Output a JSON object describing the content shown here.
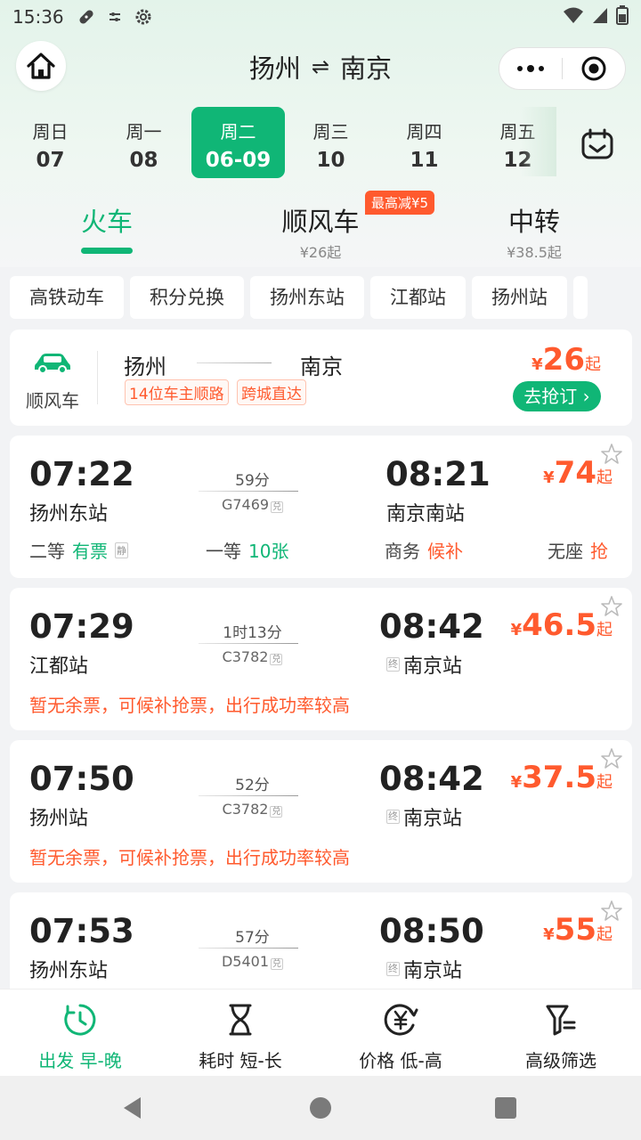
{
  "status": {
    "time": "15:36"
  },
  "header": {
    "from": "扬州",
    "to": "南京",
    "swap_symbol": "⇌"
  },
  "dates": [
    {
      "weekday": "周日",
      "day": "07"
    },
    {
      "weekday": "周一",
      "day": "08"
    },
    {
      "weekday": "周二",
      "day": "06-09",
      "active": true
    },
    {
      "weekday": "周三",
      "day": "10"
    },
    {
      "weekday": "周四",
      "day": "11"
    },
    {
      "weekday": "周五",
      "day": "12"
    }
  ],
  "modes": [
    {
      "label": "火车",
      "sub": ""
    },
    {
      "label": "顺风车",
      "sub": "¥26起",
      "promo": "最高减¥5"
    },
    {
      "label": "中转",
      "sub": "¥38.5起"
    }
  ],
  "filters": [
    "高铁动车",
    "积分兑换",
    "扬州东站",
    "江都站",
    "扬州站",
    ""
  ],
  "rideshare": {
    "label": "顺风车",
    "from": "扬州",
    "to": "南京",
    "tags": [
      "14位车主顺路",
      "跨城直达"
    ],
    "currency": "¥",
    "price": "26",
    "suffix": "起",
    "button": "去抢订"
  },
  "trains": [
    {
      "dep_time": "07:22",
      "dep_station": "扬州东站",
      "duration": "59分",
      "train_no": "G7469",
      "exchange_tag": "兑",
      "arr_time": "08:21",
      "arr_station": "南京南站",
      "terminal": false,
      "price": "74",
      "currency": "¥",
      "suffix": "起",
      "seats": [
        {
          "class": "二等",
          "status": "有票",
          "tone": "green",
          "quiet": "静"
        },
        {
          "class": "一等",
          "status": "10张",
          "tone": "green"
        },
        {
          "class": "商务",
          "status": "候补",
          "tone": "orange"
        },
        {
          "class": "无座",
          "status": "抢",
          "tone": "orange"
        }
      ]
    },
    {
      "dep_time": "07:29",
      "dep_station": "江都站",
      "duration": "1时13分",
      "train_no": "C3782",
      "exchange_tag": "兑",
      "arr_time": "08:42",
      "arr_station": "南京站",
      "terminal": true,
      "terminal_tag": "终",
      "price": "46.5",
      "currency": "¥",
      "suffix": "起",
      "notice": "暂无余票，可候补抢票，出行成功率较高"
    },
    {
      "dep_time": "07:50",
      "dep_station": "扬州站",
      "duration": "52分",
      "train_no": "C3782",
      "exchange_tag": "兑",
      "arr_time": "08:42",
      "arr_station": "南京站",
      "terminal": true,
      "terminal_tag": "终",
      "price": "37.5",
      "currency": "¥",
      "suffix": "起",
      "notice": "暂无余票，可候补抢票，出行成功率较高"
    },
    {
      "dep_time": "07:53",
      "dep_station": "扬州东站",
      "duration": "57分",
      "train_no": "D5401",
      "exchange_tag": "兑",
      "arr_time": "08:50",
      "arr_station": "南京站",
      "terminal": true,
      "terminal_tag": "终",
      "price": "55",
      "currency": "¥",
      "suffix": "起"
    }
  ],
  "bottom_tabs": [
    {
      "label": "出发 早-晚",
      "icon": "clock-icon",
      "active": true
    },
    {
      "label": "耗时 短-长",
      "icon": "hourglass-icon"
    },
    {
      "label": "价格 低-高",
      "icon": "yuan-icon"
    },
    {
      "label": "高级筛选",
      "icon": "filter-icon"
    }
  ],
  "colors": {
    "accent": "#10b676",
    "price": "#ff5a2e"
  }
}
